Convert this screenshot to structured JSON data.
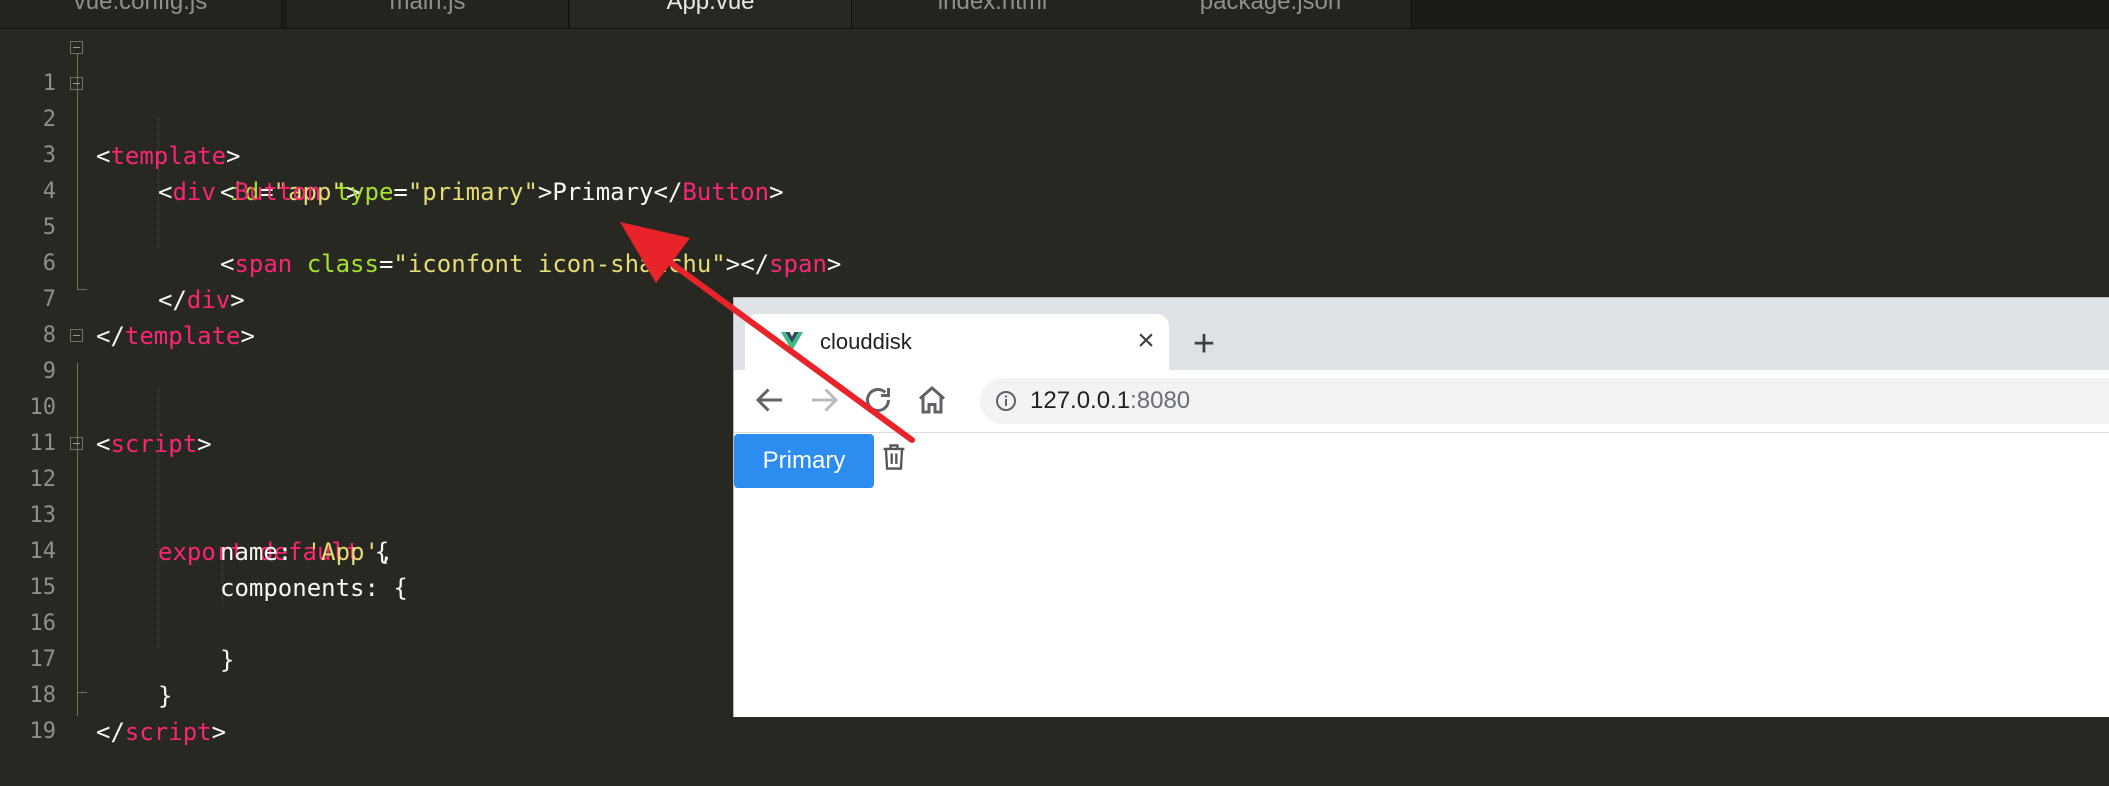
{
  "editor": {
    "tabs": [
      {
        "label": "vue.config.js"
      },
      {
        "label": "main.js"
      },
      {
        "label": "App.vue"
      },
      {
        "label": "index.html"
      },
      {
        "label": "package.json"
      }
    ],
    "active_tab": "App.vue",
    "lines": [
      {
        "n": "1"
      },
      {
        "n": "2"
      },
      {
        "n": "3"
      },
      {
        "n": "4"
      },
      {
        "n": "5"
      },
      {
        "n": "6"
      },
      {
        "n": "7"
      },
      {
        "n": "8"
      },
      {
        "n": "9"
      },
      {
        "n": "10"
      },
      {
        "n": "11"
      },
      {
        "n": "12"
      },
      {
        "n": "13"
      },
      {
        "n": "14"
      },
      {
        "n": "15"
      },
      {
        "n": "16"
      },
      {
        "n": "17"
      },
      {
        "n": "18"
      },
      {
        "n": "19"
      }
    ],
    "code": {
      "l1": [
        "<",
        "template",
        ">"
      ],
      "l2": [
        "<",
        "div",
        "id",
        "=",
        "\"app\"",
        ">"
      ],
      "l3": [
        "<",
        "Button",
        "type",
        "=",
        "\"primary\"",
        ">Primary</",
        "Button",
        ">"
      ],
      "l5": [
        "<",
        "span",
        "class",
        "=",
        "\"iconfont icon-shanchu\"",
        "></",
        "span",
        ">"
      ],
      "l6": [
        "</",
        "div",
        ">"
      ],
      "l7": [
        "</",
        "template",
        ">"
      ],
      "l9": [
        "<",
        "script",
        ">"
      ],
      "l12": [
        "export",
        "default",
        "{"
      ],
      "l13": [
        "name: ",
        "'App'",
        ","
      ],
      "l14": [
        "components: {"
      ],
      "l16": [
        "}"
      ],
      "l17": [
        "}"
      ],
      "l18": [
        "</",
        "script",
        ">"
      ]
    },
    "colors": {
      "background": "#272822",
      "tag": "#f92672",
      "attr": "#a6e22e",
      "string": "#e6db74"
    }
  },
  "browser": {
    "tab_title": "clouddisk",
    "favicon": "vue-logo-icon",
    "url_host": "127.0.0.1",
    "url_port": ":8080",
    "nav_icons": [
      "back-arrow-icon",
      "forward-arrow-icon",
      "reload-icon",
      "home-icon",
      "info-icon"
    ],
    "content": {
      "primary_button_label": "Primary",
      "primary_color": "#2d8cf0",
      "icon": "trash-icon"
    }
  },
  "annotation": {
    "color": "#e8242a",
    "shape": "red-arrow"
  }
}
